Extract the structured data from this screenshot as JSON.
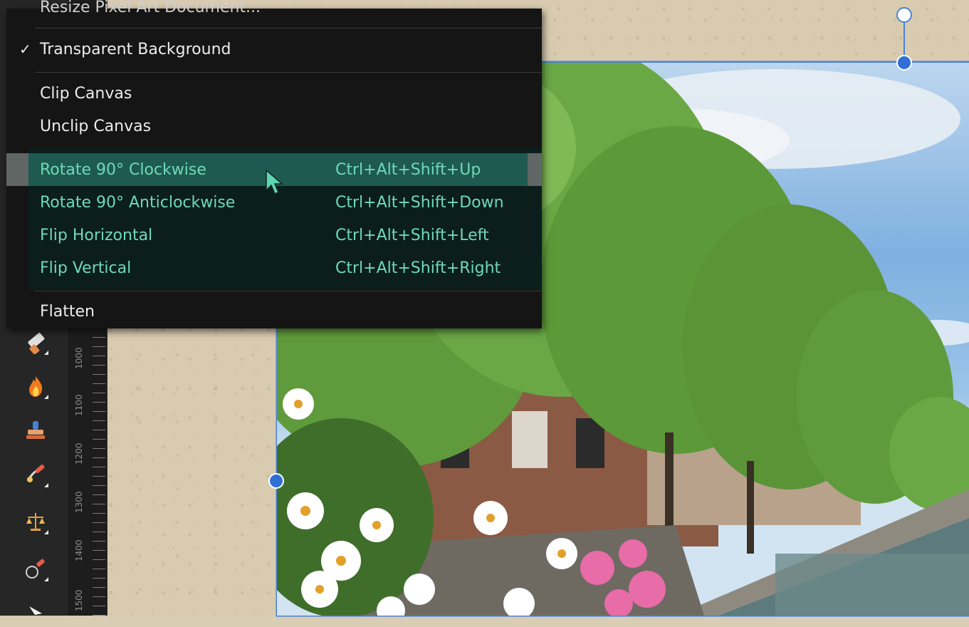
{
  "menu": {
    "cut_off_item": "Resize Pixel Art Document...",
    "items": [
      {
        "label": "Transparent Background",
        "checked": true
      },
      {
        "label": "Clip Canvas"
      },
      {
        "label": "Unclip Canvas"
      },
      {
        "label": "Rotate 90° Clockwise",
        "shortcut": "Ctrl+Alt+Shift+Up",
        "highlighted": true
      },
      {
        "label": "Rotate 90° Anticlockwise",
        "shortcut": "Ctrl+Alt+Shift+Down"
      },
      {
        "label": "Flip Horizontal",
        "shortcut": "Ctrl+Alt+Shift+Left"
      },
      {
        "label": "Flip Vertical",
        "shortcut": "Ctrl+Alt+Shift+Right"
      },
      {
        "label": "Flatten"
      }
    ],
    "check_glyph": "✓"
  },
  "ruler": {
    "labels": [
      "1000",
      "1100",
      "1200",
      "1300",
      "1400",
      "1500"
    ]
  },
  "tools": [
    {
      "icon": "eraser-icon"
    },
    {
      "icon": "burn-flame-icon"
    },
    {
      "icon": "clone-stamp-icon"
    },
    {
      "icon": "smudge-brush-icon"
    },
    {
      "icon": "balance-icon"
    },
    {
      "icon": "dodge-brush-icon"
    },
    {
      "icon": "pointer-arrow-icon"
    }
  ],
  "colors": {
    "selection_blue": "#4a82d8",
    "menu_highlight": "#1f5a50",
    "menu_green_text": "#6fd9b8",
    "menu_background": "#151515"
  }
}
